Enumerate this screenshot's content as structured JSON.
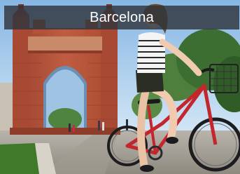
{
  "card": {
    "title": "Barcelona"
  },
  "image": {
    "subject": "arc-de-triomf-cyclist-photo"
  },
  "colors": {
    "title_bar": "#30343c",
    "title_text": "#ffffff",
    "sky": "#9fc6ea",
    "arch_brick": "#b4523a",
    "bike_frame": "#c4262e"
  }
}
